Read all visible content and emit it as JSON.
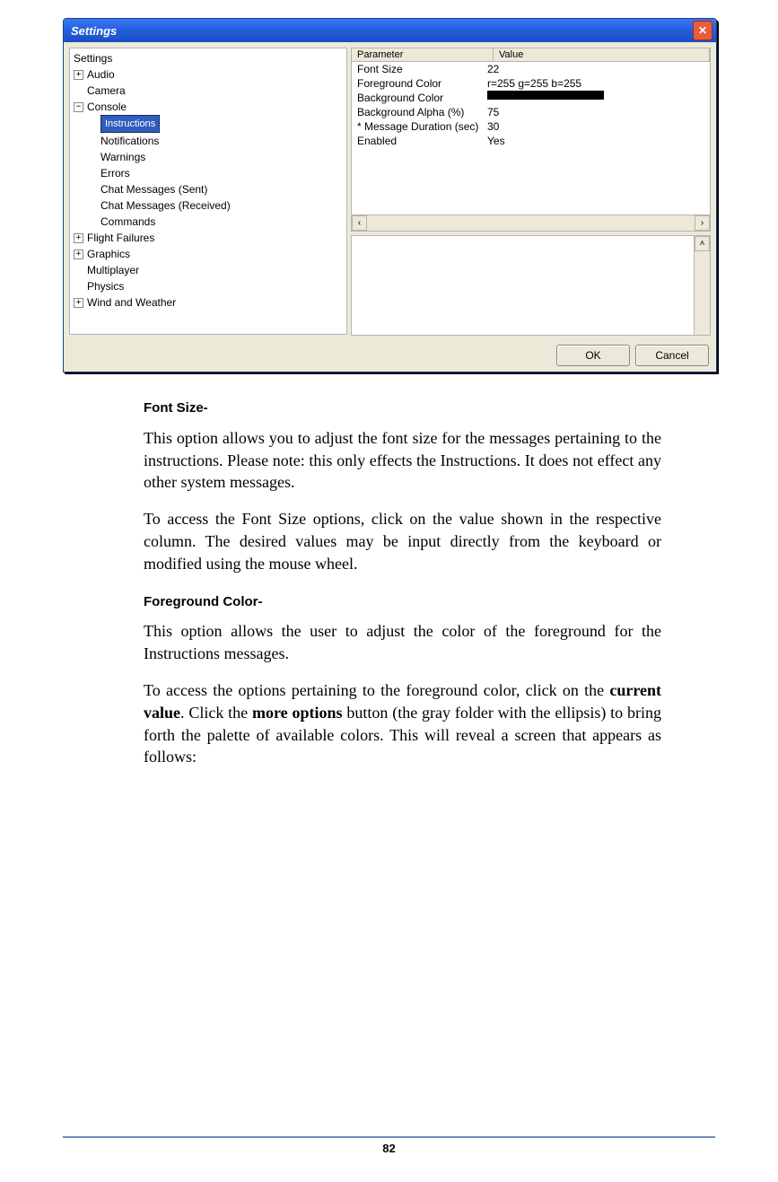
{
  "window": {
    "title": "Settings",
    "close_symbol": "✕",
    "tree": {
      "root": "Settings",
      "items": [
        {
          "label": "Audio",
          "toggle": "+"
        },
        {
          "label": "Camera"
        },
        {
          "label": "Console",
          "toggle": "−",
          "children": [
            {
              "label": "Instructions",
              "selected": true
            },
            {
              "label": "Notifications"
            },
            {
              "label": "Warnings"
            },
            {
              "label": "Errors"
            },
            {
              "label": "Chat Messages (Sent)"
            },
            {
              "label": "Chat Messages (Received)"
            },
            {
              "label": "Commands"
            }
          ]
        },
        {
          "label": "Flight Failures",
          "toggle": "+"
        },
        {
          "label": "Graphics",
          "toggle": "+"
        },
        {
          "label": "Multiplayer"
        },
        {
          "label": "Physics"
        },
        {
          "label": "Wind and Weather",
          "toggle": "+"
        }
      ]
    },
    "table": {
      "headers": {
        "param": "Parameter",
        "value": "Value"
      },
      "rows": [
        {
          "param": "Font Size",
          "value": "22"
        },
        {
          "param": "Foreground Color",
          "value": "r=255 g=255 b=255"
        },
        {
          "param": "Background Color",
          "value": ""
        },
        {
          "param": "Background Alpha (%)",
          "value": "75"
        },
        {
          "param": "* Message Duration (sec)",
          "value": "30"
        },
        {
          "param": "Enabled",
          "value": "Yes"
        }
      ]
    },
    "buttons": {
      "ok": "OK",
      "cancel": "Cancel"
    }
  },
  "doc": {
    "heading1": "Font Size-",
    "p1": "This option allows you to adjust the font size for the messages pertaining to the instructions.  Please note:  this only effects the Instructions.  It does not effect any other system messages.",
    "p2": "To access the Font Size options, click on the value shown in the respective column.  The desired values may be input directly from the keyboard or modified using the mouse wheel.",
    "heading2": "Foreground Color-",
    "p3": "This option allows the user to adjust the color of the foreground for the Instructions messages.",
    "p4a": "To access the options pertaining to the foreground color, click on the ",
    "p4b": "current value",
    "p4c": ".  Click the ",
    "p4d": "more options",
    "p4e": " button (the gray folder with the ellipsis) to bring forth the palette of available colors.  This will reveal a screen that appears as follows:"
  },
  "page_number": "82"
}
